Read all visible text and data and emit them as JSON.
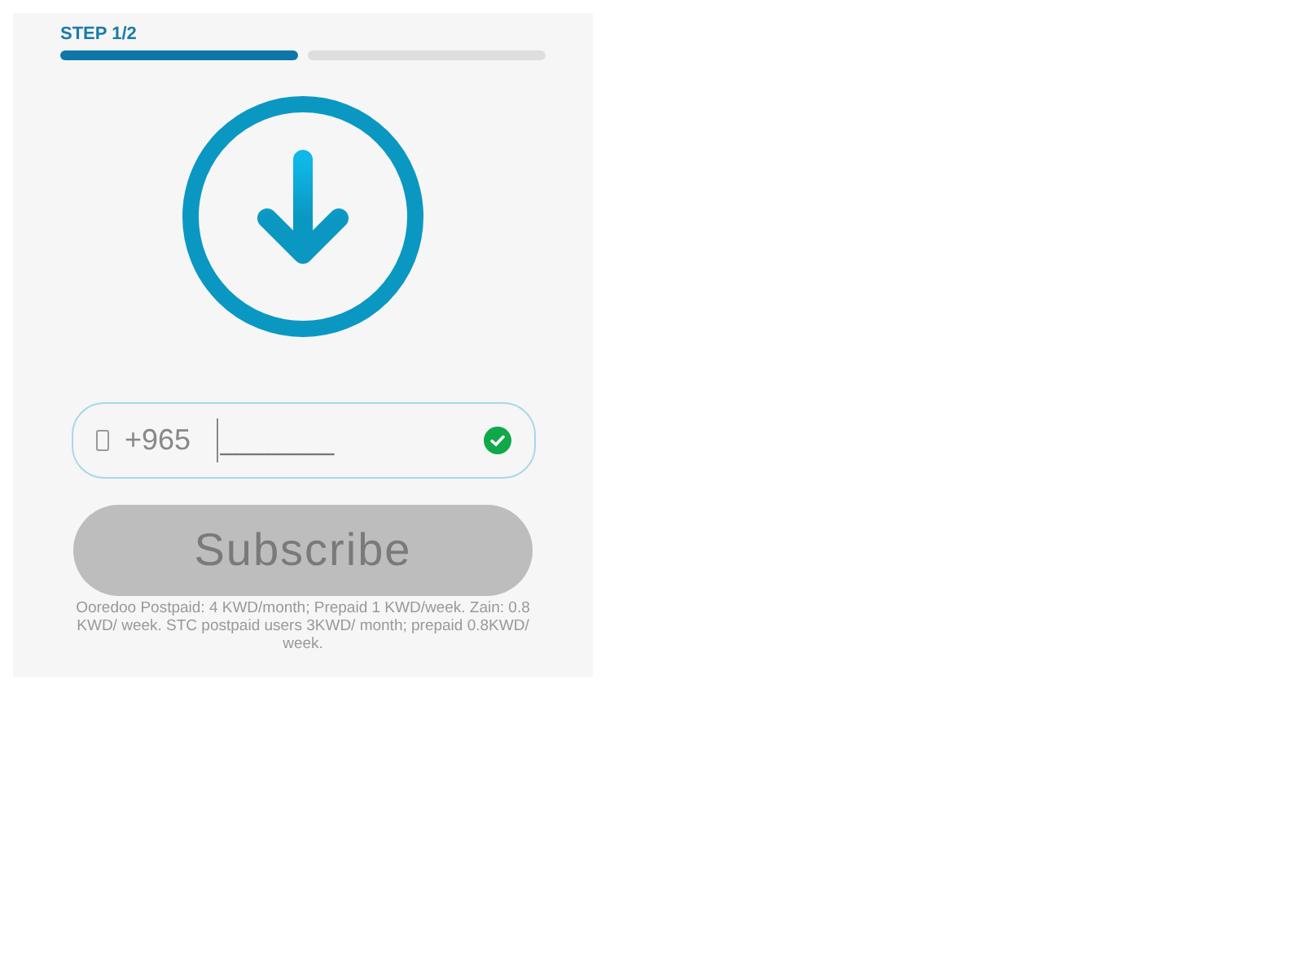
{
  "step_label": "STEP 1/2",
  "steps": [
    {
      "done": true
    },
    {
      "done": false
    }
  ],
  "phone": {
    "prefix": "+965",
    "placeholder": "_______",
    "valid": true
  },
  "subscribe": {
    "label": "Subscribe",
    "disabled": true
  },
  "terms": "Ooredoo Postpaid: 4 KWD/month; Prepaid 1 KWD/week. Zain: 0.8 KWD/ week. STC postpaid users 3KWD/ month; prepaid 0.8KWD/ week."
}
